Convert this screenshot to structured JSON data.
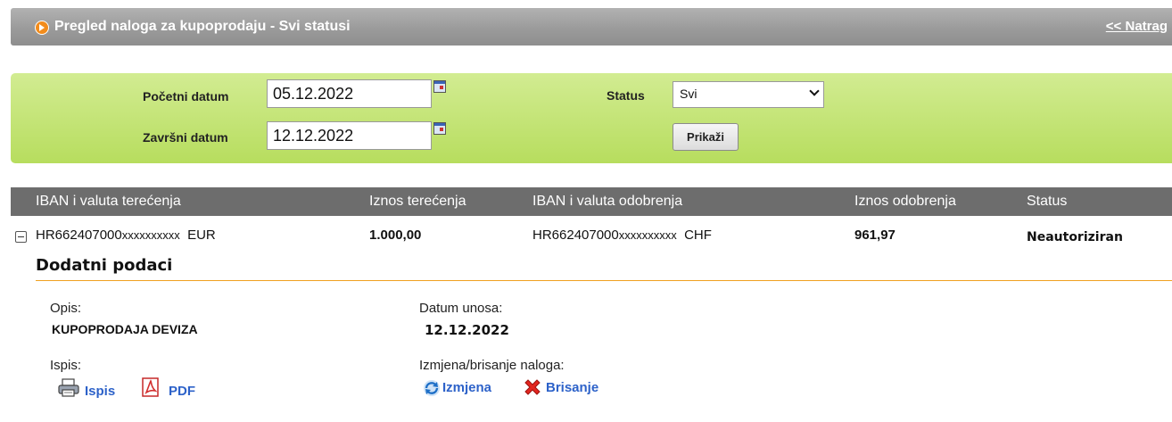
{
  "header": {
    "title": "Pregled naloga za kupoprodaju - Svi statusi",
    "back_link": "<< Natrag"
  },
  "filter": {
    "start_label": "Početni datum",
    "start_value": "05.12.2022",
    "end_label": "Završni datum",
    "end_value": "12.12.2022",
    "status_label": "Status",
    "status_value": "Svi",
    "show_button": "Prikaži"
  },
  "table": {
    "columns": [
      "IBAN i valuta terećenja",
      "Iznos terećenja",
      "IBAN i valuta odobrenja",
      "Iznos odobrenja",
      "Status"
    ],
    "row": {
      "debit_iban": "HR662407000",
      "debit_mask": "xxxxxxxxxx",
      "debit_currency": "EUR",
      "debit_amount": "1.000,00",
      "credit_iban": "HR662407000",
      "credit_mask": "xxxxxxxxxx",
      "credit_currency": "CHF",
      "credit_amount": "961,97",
      "status": "Neautoriziran"
    }
  },
  "details": {
    "title": "Dodatni podaci",
    "description_label": "Opis:",
    "description_value": "KUPOPRODAJA DEVIZA",
    "entry_date_label": "Datum unosa:",
    "entry_date_value": "12.12.2022",
    "print_label": "Ispis:",
    "print_link": "Ispis",
    "pdf_link": "PDF",
    "modify_label": "Izmjena/brisanje naloga:",
    "modify_link": "Izmjena",
    "delete_link": "Brisanje"
  },
  "colors": {
    "header_bg": "#9e9e9e",
    "filter_bg": "#c5e57a",
    "table_header_bg": "#6d6d6d",
    "accent_rule": "#f0a020",
    "link": "#2d62c9"
  },
  "icons": [
    "arrow-right-icon",
    "calendar-icon",
    "chevron-down-icon",
    "collapse-icon",
    "printer-icon",
    "pdf-icon",
    "refresh-icon",
    "delete-x-icon"
  ]
}
